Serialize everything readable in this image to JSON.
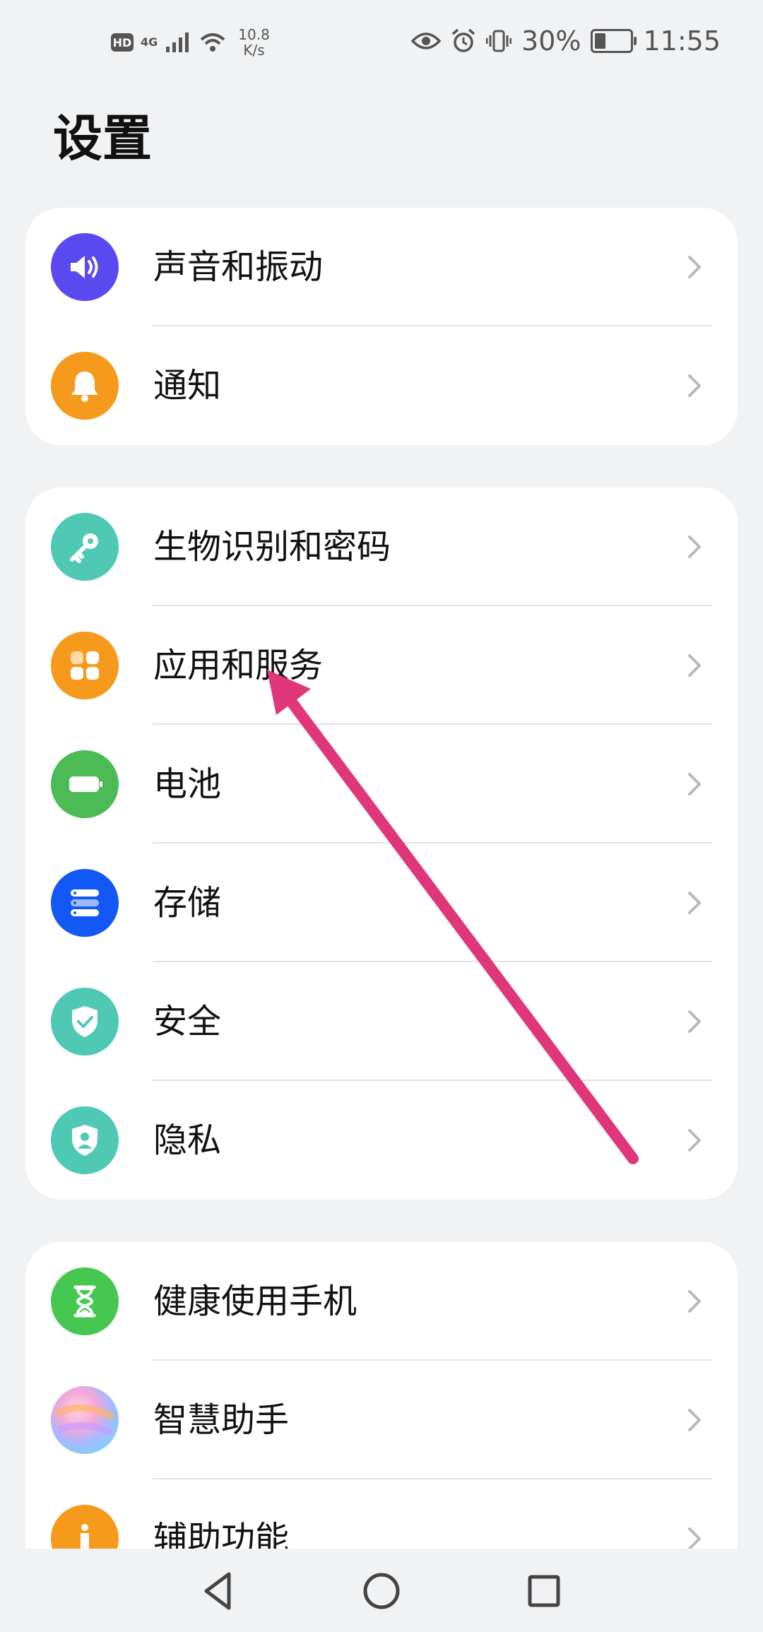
{
  "status_bar": {
    "hd": "HD",
    "network": "4G",
    "speed_value": "10.8",
    "speed_unit": "K/s",
    "battery_percent": "30%",
    "battery_level": 0.3,
    "time": "11:55"
  },
  "page_title": "设置",
  "groups": [
    {
      "items": [
        {
          "label": "声音和振动",
          "icon": "speaker-icon",
          "color": "#5b49f0"
        },
        {
          "label": "通知",
          "icon": "bell-icon",
          "color": "#f59a1d"
        }
      ]
    },
    {
      "items": [
        {
          "label": "生物识别和密码",
          "icon": "key-icon",
          "color": "#4fc9b3"
        },
        {
          "label": "应用和服务",
          "icon": "apps-grid-icon",
          "color": "#f59a1d"
        },
        {
          "label": "电池",
          "icon": "battery-icon",
          "color": "#4cba55"
        },
        {
          "label": "存储",
          "icon": "storage-icon",
          "color": "#1357f5"
        },
        {
          "label": "安全",
          "icon": "shield-check-icon",
          "color": "#4fc9b3"
        },
        {
          "label": "隐私",
          "icon": "shield-person-icon",
          "color": "#4fc9b3"
        }
      ]
    },
    {
      "items": [
        {
          "label": "健康使用手机",
          "icon": "hourglass-icon",
          "color": "#46c752"
        },
        {
          "label": "智慧助手",
          "icon": "assistant-orb-icon",
          "color": "#d9a6f0"
        },
        {
          "label": "辅助功能",
          "icon": "accessibility-icon",
          "color": "#f59a1d"
        }
      ]
    }
  ],
  "annotation_color": "#e0367a"
}
